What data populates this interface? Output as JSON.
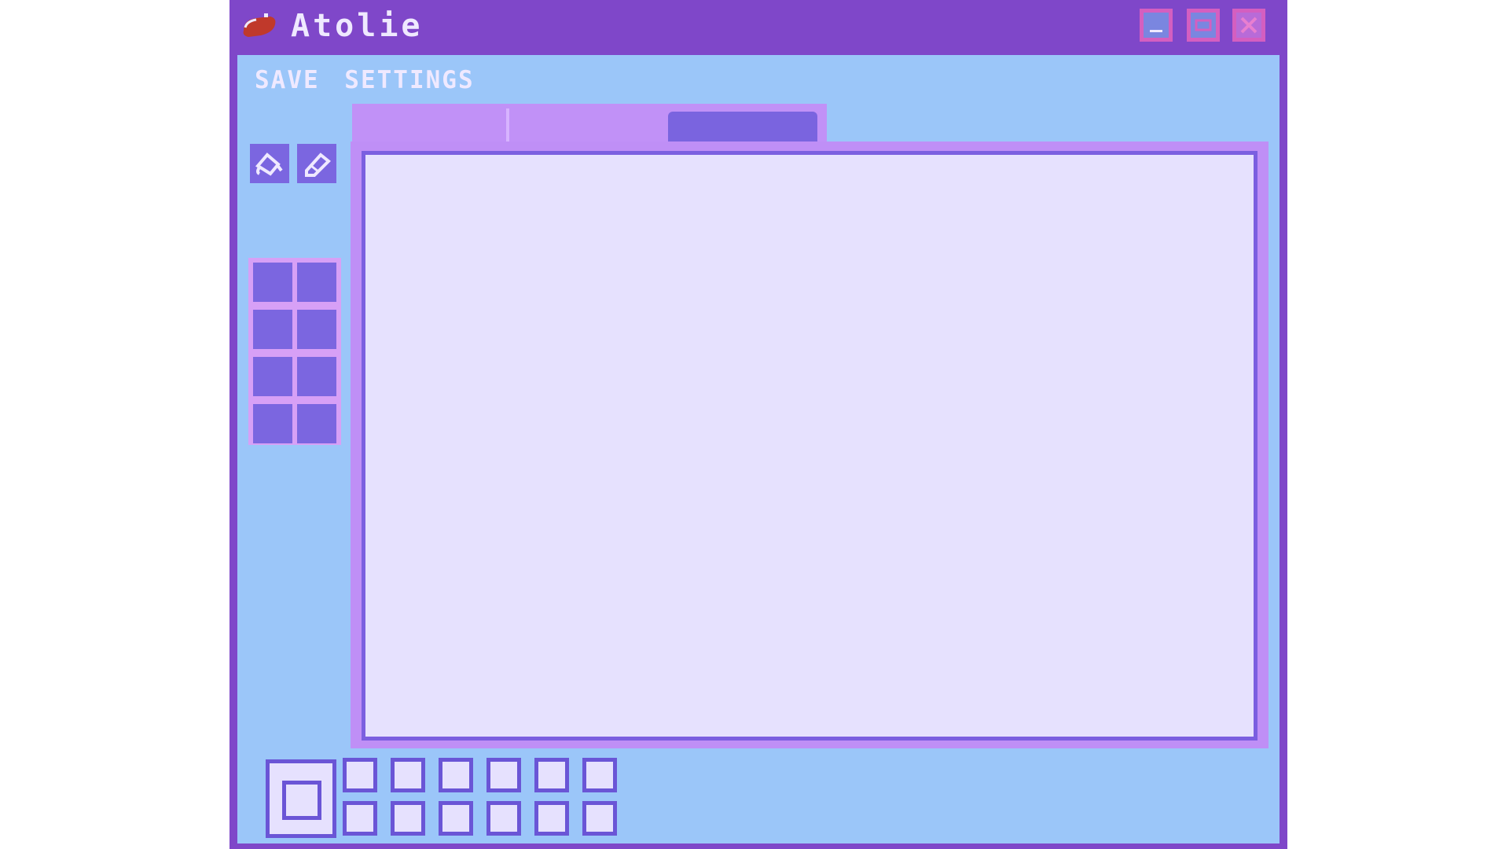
{
  "window": {
    "title": "Atolie",
    "icons": {
      "app": "red-beret-icon",
      "minimize": "minimize-icon",
      "maximize": "maximize-icon",
      "close": "close-icon"
    }
  },
  "menu": {
    "items": [
      "SAVE",
      "SETTINGS"
    ]
  },
  "toolbar": {
    "tools": [
      "paint-bucket-icon",
      "eraser-icon"
    ]
  },
  "palette": {
    "swatches": [
      "#7b66e0",
      "#7b66e0",
      "#7b66e0",
      "#7b66e0",
      "#7b66e0",
      "#7b66e0",
      "#7b66e0",
      "#7b66e0"
    ]
  },
  "tabs": {
    "count": 3,
    "active_index": 2
  },
  "colors": {
    "titlebar": "#7f47c9",
    "client": "#9bc6f9",
    "accent": "#7b66e0",
    "canvas": "#e6e1fe",
    "tab": "#c191f7",
    "app_icon": "#c0392b"
  }
}
